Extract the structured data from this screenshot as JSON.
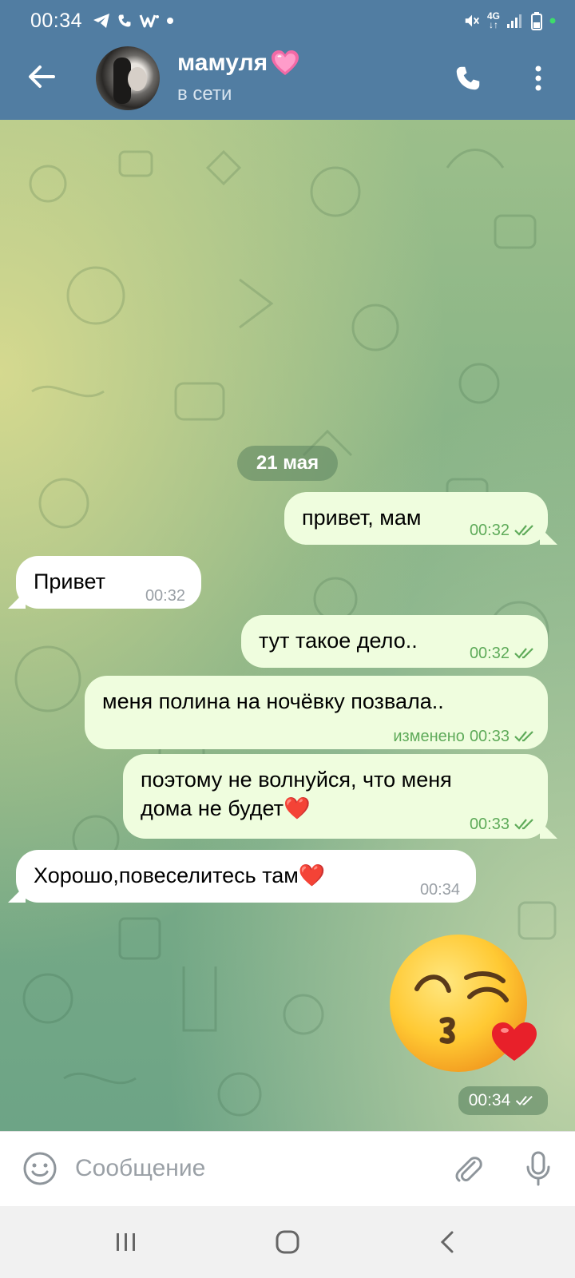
{
  "status_bar": {
    "time": "00:34",
    "network_label": "4G"
  },
  "header": {
    "contact_name": "мамуля",
    "status": "в сети"
  },
  "chat": {
    "date_separator": "21 мая",
    "messages": [
      {
        "direction": "outgoing",
        "text": "привет, мам",
        "time": "00:32",
        "edited": "",
        "read": true
      },
      {
        "direction": "incoming",
        "text": "Привет",
        "time": "00:32"
      },
      {
        "direction": "outgoing",
        "text": "тут такое дело..",
        "time": "00:32",
        "edited": "",
        "read": true
      },
      {
        "direction": "outgoing",
        "text": "меня полина на ночёвку позвала..",
        "time": "00:33",
        "edited": "изменено",
        "read": true
      },
      {
        "direction": "outgoing",
        "text_line1": "поэтому не волнуйся, что меня",
        "text_line2": "дома не будет❤️",
        "time": "00:33",
        "edited": "",
        "read": true
      },
      {
        "direction": "incoming",
        "text": "Хорошо,повеселитесь там❤️",
        "time": "00:34"
      },
      {
        "direction": "outgoing",
        "emoji": "😘",
        "time": "00:34",
        "read": true
      }
    ]
  },
  "input": {
    "placeholder": "Сообщение"
  },
  "colors": {
    "header_bg": "#517da2",
    "outgoing_bubble": "#effdde",
    "incoming_bubble": "#ffffff",
    "check_color": "#5fab5a"
  },
  "icons": [
    "back-arrow-icon",
    "phone-icon",
    "more-vertical-icon",
    "emoji-icon",
    "paperclip-icon",
    "microphone-icon",
    "nav-recents-icon",
    "nav-home-icon",
    "nav-back-icon"
  ]
}
